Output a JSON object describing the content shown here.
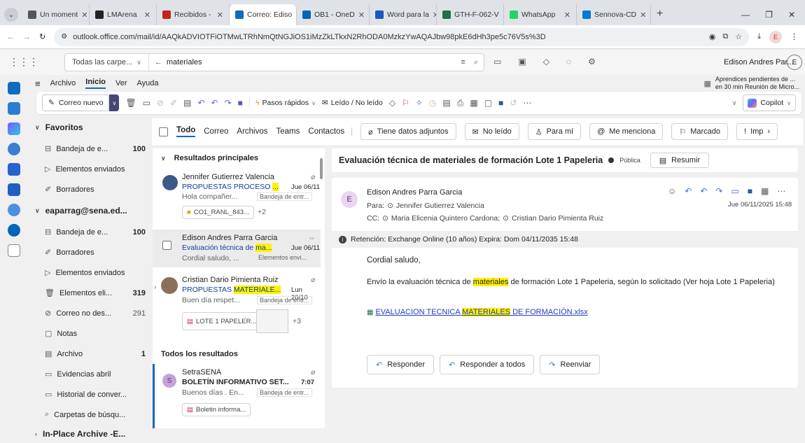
{
  "browser": {
    "tabs": [
      {
        "label": "Un moment",
        "color": "#555555"
      },
      {
        "label": "LMArena",
        "color": "#222222"
      },
      {
        "label": "Recibidos - ",
        "color": "#c5221f"
      },
      {
        "label": "Correo: Ediso",
        "color": "#0f6cbd",
        "active": true
      },
      {
        "label": "OB1 - OneD",
        "color": "#0364b8"
      },
      {
        "label": "Word para la",
        "color": "#185abd"
      },
      {
        "label": "GTH-F-062-V",
        "color": "#1e7145"
      },
      {
        "label": "WhatsApp",
        "color": "#25d366"
      },
      {
        "label": "Sennova-CD",
        "color": "#0078d4"
      }
    ],
    "url": "outlook.office.com/mail/id/AAQkADVIOTFiOTMwLTRhNmQtNGJiOS1iMzZkLTkxN2RhODA0MzkzYwAQAJbw98pkE6dHh3pe5c76V5s%3D",
    "profile_initial": "E"
  },
  "header": {
    "scope": "Todas las carpe...",
    "search_value": "materiales",
    "user_name": "Edison Andres Par...",
    "user_initial": "E"
  },
  "menu": {
    "items": [
      "Archivo",
      "Inicio",
      "Ver",
      "Ayuda"
    ],
    "reminder_title": "Aprendices pendientes de ...",
    "reminder_sub": "en 30 min Reunión de Micro..."
  },
  "ribbon": {
    "new_mail": "Correo nuevo",
    "quick_steps": "Pasos rápidos",
    "read_unread": "Leído / No leído",
    "copilot": "Copilot"
  },
  "folders": {
    "favorites_label": "Favoritos",
    "favorites": [
      {
        "label": "Bandeja de e...",
        "count": "100",
        "icon": "inbox-icon"
      },
      {
        "label": "Elementos enviados",
        "count": "",
        "icon": "send-icon"
      },
      {
        "label": "Borradores",
        "count": "",
        "icon": "draft-icon"
      }
    ],
    "account_label": "eaparrag@sena.ed...",
    "account": [
      {
        "label": "Bandeja de e...",
        "count": "100",
        "bold": true,
        "icon": "inbox-icon"
      },
      {
        "label": "Borradores",
        "count": "",
        "icon": "draft-icon"
      },
      {
        "label": "Elementos enviados",
        "count": "",
        "icon": "send-icon"
      },
      {
        "label": "Elementos eli...",
        "count": "319",
        "bold": true,
        "icon": "trash-icon"
      },
      {
        "label": "Correo no des...",
        "count": "291",
        "bold": false,
        "icon": "junk-icon"
      },
      {
        "label": "Notas",
        "count": "",
        "icon": "note-icon"
      },
      {
        "label": "Archivo",
        "count": "1",
        "bold": true,
        "icon": "archive-icon"
      },
      {
        "label": "Evidencias abril",
        "count": "",
        "icon": "folder-icon"
      },
      {
        "label": "Historial de conver...",
        "count": "",
        "icon": "folder-icon"
      },
      {
        "label": "Carpetas de búsqu...",
        "count": "",
        "icon": "search-folder-icon"
      }
    ],
    "archive_label": "In-Place Archive -E..."
  },
  "filter": {
    "tabs": [
      "Todo",
      "Correo",
      "Archivos",
      "Teams",
      "Contactos"
    ],
    "chips": [
      "Tiene datos adjuntos",
      "No leído",
      "Para mí",
      "Me menciona",
      "Marcado",
      "Imp"
    ]
  },
  "list": {
    "section_top": "Resultados principales",
    "section_all": "Todos los resultados",
    "messages": [
      {
        "sender": "Jennifer Gutierrez Valencia",
        "subject_pre": "PROPUESTAS PROCESO ",
        "subject_hl": "...",
        "date": "Jue 06/11",
        "preview": "Hola compañer...",
        "folder": "Bandeja de entr...",
        "attachment": "CO1_RANL_843...",
        "more": "+2"
      },
      {
        "sender": "Edison Andres Parra Garcia",
        "subject_pre": "Evaluación técnica de ",
        "subject_hl": "ma...",
        "date": "Jue 06/11",
        "preview": "Cordial saludo, ...",
        "folder": "Elementos envi..."
      },
      {
        "sender": "Cristian Dario Pimienta Ruiz",
        "subject_pre": "PROPUESTAS ",
        "subject_hl": "MATERIALE...",
        "date": "Lun 20/10",
        "preview": "Buen día respet...",
        "folder": "Bandeja de entr...",
        "attachment": "LOTE 1 PAPELER...",
        "more": "+3"
      },
      {
        "sender": "SetraSENA",
        "subject_pre": "BOLETÍN INFORMATIVO SET...",
        "subject_hl": "",
        "date": "7:07",
        "preview": "Buenos días . En...",
        "folder": "Bandeja de entr...",
        "attachment": "Boletin informa...",
        "initial": "S"
      }
    ]
  },
  "reading": {
    "subject": "Evaluación técnica de materiales de formación Lote 1 Papeleria",
    "visibility": "Pública",
    "summarize": "Resumir",
    "from": "Edison Andres Parra Garcia",
    "from_initial": "E",
    "to_label": "Para:",
    "to": "Jennifer Gutierrez Valencia",
    "cc_label": "CC:",
    "cc1": "Maria Elicenia Quintero Cardona;",
    "cc2": "Cristian Dario Pimienta Ruiz",
    "date": "Jue 06/11/2025 15:48",
    "retention": "Retención: Exchange Online (10 años) Expira: Dom 04/11/2035 15:48",
    "greeting": "Cordial saludo,",
    "body_pre": "Envío la evaluación técnica de ",
    "body_hl": "materiales",
    "body_post": " de formación Lote 1 Papeleria, según lo solicitado (Ver hoja Lote 1 Papeleria)",
    "file_pre": "EVALUACION TECNICA ",
    "file_hl": "MATERIALES",
    "file_post": " DE FORMACIÓN.xlsx",
    "reply": "Responder",
    "reply_all": "Responder a todos",
    "forward": "Reenviar"
  }
}
